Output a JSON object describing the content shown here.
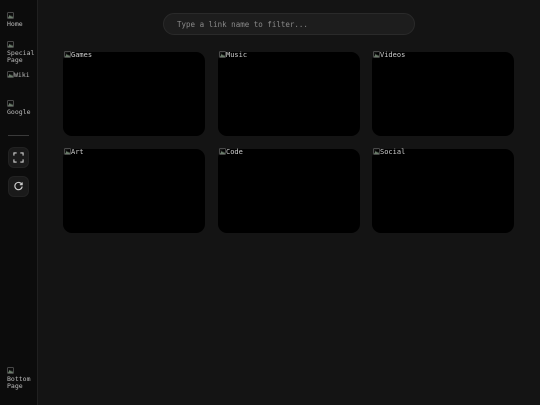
{
  "sidebar": {
    "items": [
      {
        "label": "Home"
      },
      {
        "label": "Special Page"
      },
      {
        "label": "Wiki"
      },
      {
        "label": "Google"
      }
    ],
    "bottom_item": {
      "label": "Bottom Page"
    },
    "fullscreen_icon": "fullscreen-icon",
    "refresh_icon": "refresh-icon"
  },
  "search": {
    "placeholder": "Type a link name to filter..."
  },
  "cards": [
    {
      "title": "Games"
    },
    {
      "title": "Music"
    },
    {
      "title": "Videos"
    },
    {
      "title": "Art"
    },
    {
      "title": "Code"
    },
    {
      "title": "Social"
    }
  ],
  "colors": {
    "background": "#141414",
    "sidebar": "#0c0c0c",
    "card": "#000000",
    "text": "#cfcfcf"
  }
}
